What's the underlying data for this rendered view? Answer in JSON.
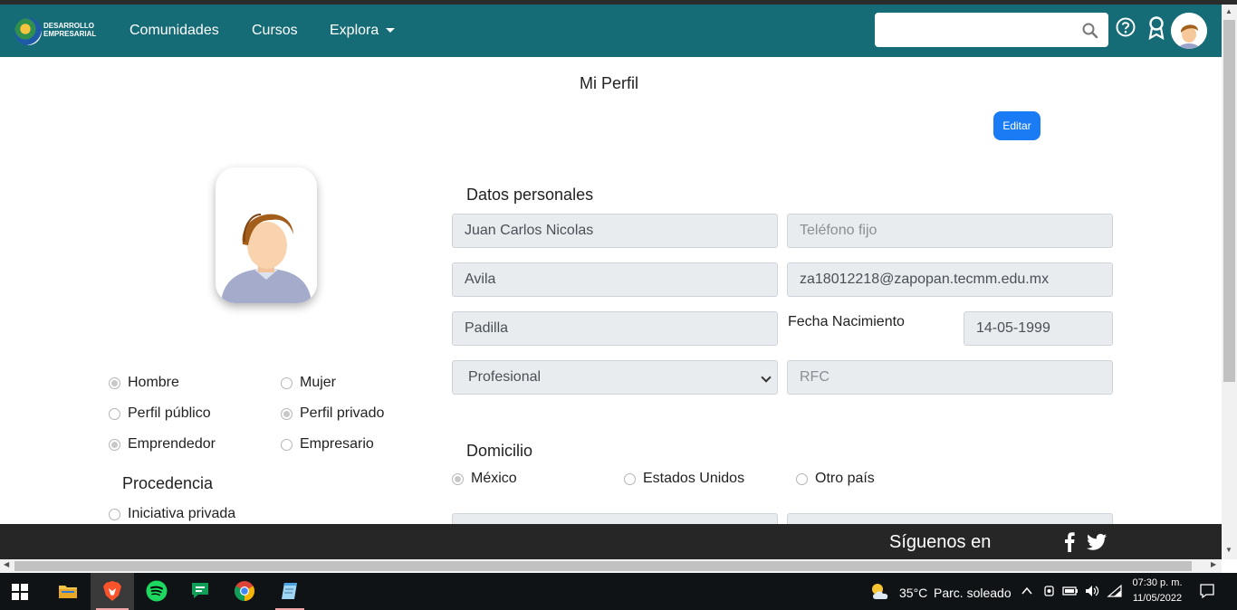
{
  "navbar": {
    "logo_text_1": "DESARROLLO",
    "logo_text_2": "EMPRESARIAL",
    "links": [
      "Comunidades",
      "Cursos",
      "Explora"
    ],
    "search_placeholder": ""
  },
  "page": {
    "title": "Mi Perfil",
    "edit_label": "Editar"
  },
  "profile_options": {
    "gender": [
      {
        "label": "Hombre",
        "checked": true
      },
      {
        "label": "Mujer",
        "checked": false
      }
    ],
    "visibility": [
      {
        "label": "Perfil público",
        "checked": false
      },
      {
        "label": "Perfil privado",
        "checked": true
      }
    ],
    "role": [
      {
        "label": "Emprendedor",
        "checked": true
      },
      {
        "label": "Empresario",
        "checked": false
      }
    ],
    "procedencia_title": "Procedencia",
    "procedencia": [
      {
        "label": "Iniciativa privada",
        "checked": false
      }
    ]
  },
  "personal": {
    "title": "Datos personales",
    "nombre": "Juan Carlos Nicolas",
    "telefono_placeholder": "Teléfono fijo",
    "apellido_paterno": "Avila",
    "email": "za18012218@zapopan.tecmm.edu.mx",
    "apellido_materno": "Padilla",
    "fecha_label": "Fecha Nacimiento",
    "fecha": "14-05-1999",
    "nivel": "Profesional",
    "rfc_placeholder": "RFC"
  },
  "domicilio": {
    "title": "Domicilio",
    "countries": [
      {
        "label": "México",
        "checked": true
      },
      {
        "label": "Estados Unidos",
        "checked": false
      },
      {
        "label": "Otro país",
        "checked": false
      }
    ]
  },
  "footer": {
    "follow_text": "Síguenos en"
  },
  "taskbar": {
    "weather_temp": "35°C",
    "weather_text": "Parc. soleado",
    "time": "07:30 p. m.",
    "date": "11/05/2022"
  },
  "colors": {
    "navbar": "#156b76",
    "edit_button": "#1a7cf4",
    "footer": "#262626"
  }
}
